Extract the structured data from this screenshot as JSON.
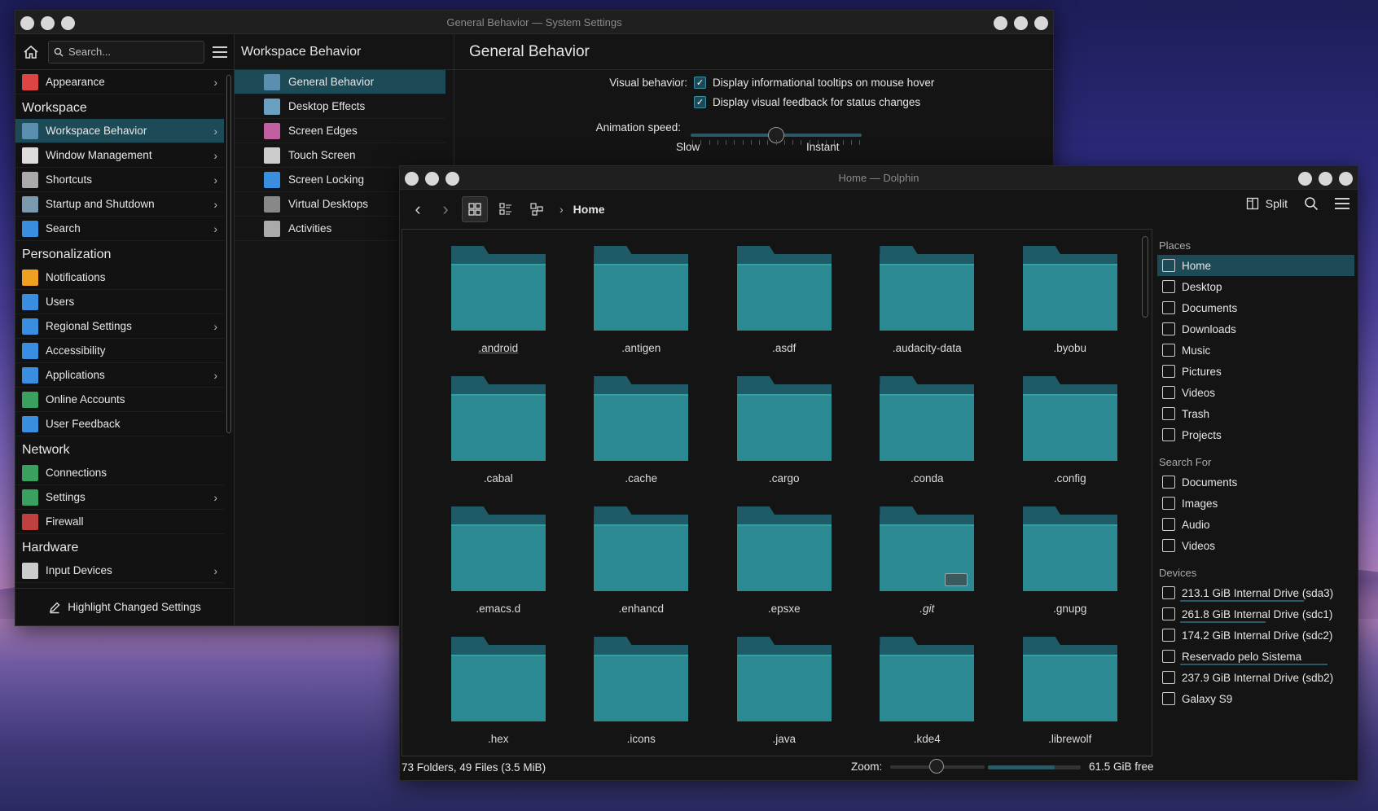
{
  "settings": {
    "title": "General Behavior — System Settings",
    "search_placeholder": "Search...",
    "sidebar": [
      {
        "type": "item",
        "label": "Appearance",
        "chev": true,
        "color": "#d44"
      },
      {
        "type": "head",
        "label": "Workspace"
      },
      {
        "type": "item",
        "label": "Workspace Behavior",
        "chev": true,
        "sel": true,
        "color": "#5a8fb0"
      },
      {
        "type": "item",
        "label": "Window Management",
        "chev": true,
        "color": "#ddd"
      },
      {
        "type": "item",
        "label": "Shortcuts",
        "chev": true,
        "color": "#aaa"
      },
      {
        "type": "item",
        "label": "Startup and Shutdown",
        "chev": true,
        "color": "#7a9ab0"
      },
      {
        "type": "item",
        "label": "Search",
        "chev": true,
        "color": "#3a8ee0"
      },
      {
        "type": "head",
        "label": "Personalization"
      },
      {
        "type": "item",
        "label": "Notifications",
        "chev": false,
        "color": "#f0a020"
      },
      {
        "type": "item",
        "label": "Users",
        "chev": false,
        "color": "#3a8ee0"
      },
      {
        "type": "item",
        "label": "Regional Settings",
        "chev": true,
        "color": "#3a8ee0"
      },
      {
        "type": "item",
        "label": "Accessibility",
        "chev": false,
        "color": "#3a8ee0"
      },
      {
        "type": "item",
        "label": "Applications",
        "chev": true,
        "color": "#3a8ee0"
      },
      {
        "type": "item",
        "label": "Online Accounts",
        "chev": false,
        "color": "#3aa060"
      },
      {
        "type": "item",
        "label": "User Feedback",
        "chev": false,
        "color": "#3a8ee0"
      },
      {
        "type": "head",
        "label": "Network"
      },
      {
        "type": "item",
        "label": "Connections",
        "chev": false,
        "color": "#3aa060"
      },
      {
        "type": "item",
        "label": "Settings",
        "chev": true,
        "color": "#3aa060"
      },
      {
        "type": "item",
        "label": "Firewall",
        "chev": false,
        "color": "#c04040"
      },
      {
        "type": "head",
        "label": "Hardware"
      },
      {
        "type": "item",
        "label": "Input Devices",
        "chev": true,
        "color": "#ccc"
      }
    ],
    "footer_label": "Highlight Changed Settings",
    "mid_title": "Workspace Behavior",
    "mid_items": [
      {
        "label": "General Behavior",
        "sel": true
      },
      {
        "label": "Desktop Effects"
      },
      {
        "label": "Screen Edges"
      },
      {
        "label": "Touch Screen"
      },
      {
        "label": "Screen Locking"
      },
      {
        "label": "Virtual Desktops"
      },
      {
        "label": "Activities"
      }
    ],
    "main_title": "General Behavior",
    "visual_behavior_label": "Visual behavior:",
    "tooltips_label": "Display informational tooltips on mouse hover",
    "feedback_label": "Display visual feedback for status changes",
    "animation_label": "Animation speed:",
    "slow_label": "Slow",
    "instant_label": "Instant",
    "animation_speed_fraction": 0.5
  },
  "dolphin": {
    "title": "Home — Dolphin",
    "breadcrumb": "Home",
    "split_label": "Split",
    "folders": [
      {
        "name": ".android",
        "ul": true
      },
      {
        "name": ".antigen"
      },
      {
        "name": ".asdf"
      },
      {
        "name": ".audacity-data"
      },
      {
        "name": ".byobu"
      },
      {
        "name": ".cabal"
      },
      {
        "name": ".cache"
      },
      {
        "name": ".cargo"
      },
      {
        "name": ".conda"
      },
      {
        "name": ".config"
      },
      {
        "name": ".emacs.d"
      },
      {
        "name": ".enhancd"
      },
      {
        "name": ".epsxe"
      },
      {
        "name": ".git",
        "it": true,
        "badge": true
      },
      {
        "name": ".gnupg"
      },
      {
        "name": ".hex"
      },
      {
        "name": ".icons"
      },
      {
        "name": ".java"
      },
      {
        "name": ".kde4"
      },
      {
        "name": ".librewolf"
      }
    ],
    "places_head": "Places",
    "places": [
      {
        "label": "Home",
        "sel": true
      },
      {
        "label": "Desktop"
      },
      {
        "label": "Documents"
      },
      {
        "label": "Downloads"
      },
      {
        "label": "Music"
      },
      {
        "label": "Pictures"
      },
      {
        "label": "Videos"
      },
      {
        "label": "Trash"
      },
      {
        "label": "Projects"
      }
    ],
    "search_head": "Search For",
    "search_for": [
      {
        "label": "Documents"
      },
      {
        "label": "Images"
      },
      {
        "label": "Audio"
      },
      {
        "label": "Videos"
      }
    ],
    "devices_head": "Devices",
    "devices": [
      {
        "label": "213.1 GiB Internal Drive (sda3)",
        "usage": 0.8
      },
      {
        "label": "261.8 GiB Internal Drive (sdc1)",
        "usage": 0.55
      },
      {
        "label": "174.2 GiB Internal Drive (sdc2)",
        "usage": 0
      },
      {
        "label": "Reservado pelo Sistema",
        "usage": 0.95
      },
      {
        "label": "237.9 GiB Internal Drive (sdb2)",
        "usage": 0
      },
      {
        "label": "Galaxy S9",
        "usage": 0
      }
    ],
    "status_text": "73 Folders, 49 Files (3.5 MiB)",
    "zoom_label": "Zoom:",
    "free_label": "61.5 GiB free",
    "disk_usage_fraction": 0.72
  }
}
